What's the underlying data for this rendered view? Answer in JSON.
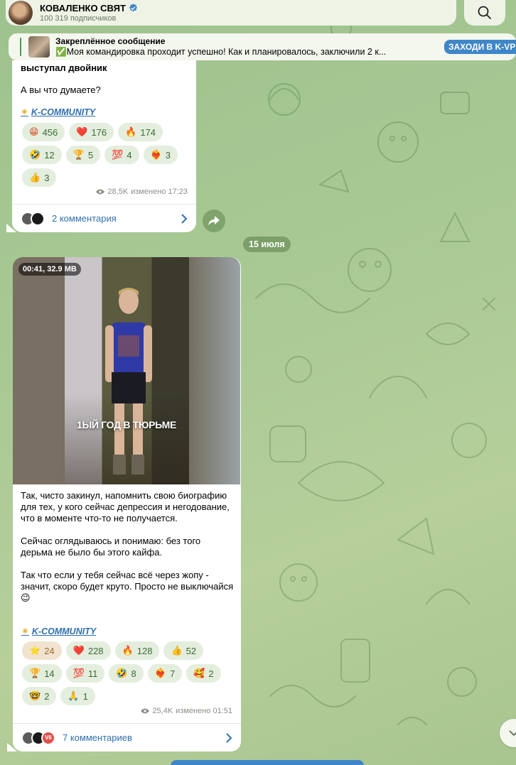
{
  "header": {
    "channel_name": "КОВАЛЕНКО СВЯТ",
    "subscribers": "100 319 подписчиков",
    "verified_icon": "verified-badge-icon",
    "search_icon": "search-icon"
  },
  "pinned": {
    "title": "Закреплённое сообщение",
    "message": "✅Моя командировка проходит успешно!  Как и планировалось, заключили 2 к...",
    "button_label": "ЗАХОДИ В K-VPN"
  },
  "post1": {
    "text_bold": "выступал двойник",
    "text": "А вы что думаете?",
    "community": "K-COMMUNITY",
    "reactions": [
      {
        "emoji": "😁",
        "count": "456"
      },
      {
        "emoji": "❤️",
        "count": "176"
      },
      {
        "emoji": "🔥",
        "count": "174"
      },
      {
        "emoji": "🤣",
        "count": "12"
      },
      {
        "emoji": "🏆",
        "count": "5"
      },
      {
        "emoji": "💯",
        "count": "4"
      },
      {
        "emoji": "❤️‍🔥",
        "count": "3"
      },
      {
        "emoji": "👍",
        "count": "3"
      }
    ],
    "views": "28,5K",
    "edited": "изменено 17:23",
    "comments": "2 комментария"
  },
  "date_separator": "15 июля",
  "post2": {
    "video_badge": "00:41, 32.9 MB",
    "video_caption": "1ЫЙ ГОД В ТЮРЬМЕ",
    "paragraphs": [
      "Так, чисто закинул, напомнить свою биографию для тех, у кого сейчас депрессия и негодование, что в моменте что-то не получается.",
      "Сейчас оглядываюсь и понимаю: без того дерьма не было бы этого кайфа.",
      "Так что если у тебя сейчас всё через жопу - значит, скоро будет круто. Просто не выключайся😉"
    ],
    "community": "K-COMMUNITY",
    "reactions": [
      {
        "emoji": "⭐",
        "count": "24",
        "active": true
      },
      {
        "emoji": "❤️",
        "count": "228"
      },
      {
        "emoji": "🔥",
        "count": "128"
      },
      {
        "emoji": "👍",
        "count": "52"
      },
      {
        "emoji": "🏆",
        "count": "14"
      },
      {
        "emoji": "💯",
        "count": "11"
      },
      {
        "emoji": "🤣",
        "count": "8"
      },
      {
        "emoji": "❤️‍🔥",
        "count": "7"
      },
      {
        "emoji": "🥰",
        "count": "2"
      },
      {
        "emoji": "🤓",
        "count": "2"
      },
      {
        "emoji": "🙏",
        "count": "1"
      }
    ],
    "views": "25,4K",
    "edited": "изменено 01:51",
    "comments": "7 комментариев",
    "commenter_badge": "V6"
  }
}
